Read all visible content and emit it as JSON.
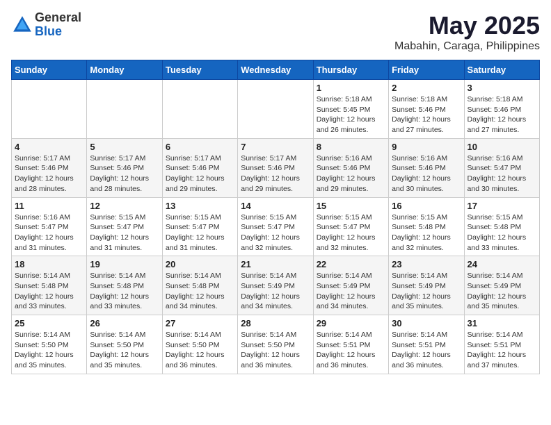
{
  "logo": {
    "general": "General",
    "blue": "Blue"
  },
  "title": "May 2025",
  "location": "Mabahin, Caraga, Philippines",
  "days_header": [
    "Sunday",
    "Monday",
    "Tuesday",
    "Wednesday",
    "Thursday",
    "Friday",
    "Saturday"
  ],
  "weeks": [
    [
      {
        "day": "",
        "info": ""
      },
      {
        "day": "",
        "info": ""
      },
      {
        "day": "",
        "info": ""
      },
      {
        "day": "",
        "info": ""
      },
      {
        "day": "1",
        "info": "Sunrise: 5:18 AM\nSunset: 5:45 PM\nDaylight: 12 hours\nand 26 minutes."
      },
      {
        "day": "2",
        "info": "Sunrise: 5:18 AM\nSunset: 5:46 PM\nDaylight: 12 hours\nand 27 minutes."
      },
      {
        "day": "3",
        "info": "Sunrise: 5:18 AM\nSunset: 5:46 PM\nDaylight: 12 hours\nand 27 minutes."
      }
    ],
    [
      {
        "day": "4",
        "info": "Sunrise: 5:17 AM\nSunset: 5:46 PM\nDaylight: 12 hours\nand 28 minutes."
      },
      {
        "day": "5",
        "info": "Sunrise: 5:17 AM\nSunset: 5:46 PM\nDaylight: 12 hours\nand 28 minutes."
      },
      {
        "day": "6",
        "info": "Sunrise: 5:17 AM\nSunset: 5:46 PM\nDaylight: 12 hours\nand 29 minutes."
      },
      {
        "day": "7",
        "info": "Sunrise: 5:17 AM\nSunset: 5:46 PM\nDaylight: 12 hours\nand 29 minutes."
      },
      {
        "day": "8",
        "info": "Sunrise: 5:16 AM\nSunset: 5:46 PM\nDaylight: 12 hours\nand 29 minutes."
      },
      {
        "day": "9",
        "info": "Sunrise: 5:16 AM\nSunset: 5:46 PM\nDaylight: 12 hours\nand 30 minutes."
      },
      {
        "day": "10",
        "info": "Sunrise: 5:16 AM\nSunset: 5:47 PM\nDaylight: 12 hours\nand 30 minutes."
      }
    ],
    [
      {
        "day": "11",
        "info": "Sunrise: 5:16 AM\nSunset: 5:47 PM\nDaylight: 12 hours\nand 31 minutes."
      },
      {
        "day": "12",
        "info": "Sunrise: 5:15 AM\nSunset: 5:47 PM\nDaylight: 12 hours\nand 31 minutes."
      },
      {
        "day": "13",
        "info": "Sunrise: 5:15 AM\nSunset: 5:47 PM\nDaylight: 12 hours\nand 31 minutes."
      },
      {
        "day": "14",
        "info": "Sunrise: 5:15 AM\nSunset: 5:47 PM\nDaylight: 12 hours\nand 32 minutes."
      },
      {
        "day": "15",
        "info": "Sunrise: 5:15 AM\nSunset: 5:47 PM\nDaylight: 12 hours\nand 32 minutes."
      },
      {
        "day": "16",
        "info": "Sunrise: 5:15 AM\nSunset: 5:48 PM\nDaylight: 12 hours\nand 32 minutes."
      },
      {
        "day": "17",
        "info": "Sunrise: 5:15 AM\nSunset: 5:48 PM\nDaylight: 12 hours\nand 33 minutes."
      }
    ],
    [
      {
        "day": "18",
        "info": "Sunrise: 5:14 AM\nSunset: 5:48 PM\nDaylight: 12 hours\nand 33 minutes."
      },
      {
        "day": "19",
        "info": "Sunrise: 5:14 AM\nSunset: 5:48 PM\nDaylight: 12 hours\nand 33 minutes."
      },
      {
        "day": "20",
        "info": "Sunrise: 5:14 AM\nSunset: 5:48 PM\nDaylight: 12 hours\nand 34 minutes."
      },
      {
        "day": "21",
        "info": "Sunrise: 5:14 AM\nSunset: 5:49 PM\nDaylight: 12 hours\nand 34 minutes."
      },
      {
        "day": "22",
        "info": "Sunrise: 5:14 AM\nSunset: 5:49 PM\nDaylight: 12 hours\nand 34 minutes."
      },
      {
        "day": "23",
        "info": "Sunrise: 5:14 AM\nSunset: 5:49 PM\nDaylight: 12 hours\nand 35 minutes."
      },
      {
        "day": "24",
        "info": "Sunrise: 5:14 AM\nSunset: 5:49 PM\nDaylight: 12 hours\nand 35 minutes."
      }
    ],
    [
      {
        "day": "25",
        "info": "Sunrise: 5:14 AM\nSunset: 5:50 PM\nDaylight: 12 hours\nand 35 minutes."
      },
      {
        "day": "26",
        "info": "Sunrise: 5:14 AM\nSunset: 5:50 PM\nDaylight: 12 hours\nand 35 minutes."
      },
      {
        "day": "27",
        "info": "Sunrise: 5:14 AM\nSunset: 5:50 PM\nDaylight: 12 hours\nand 36 minutes."
      },
      {
        "day": "28",
        "info": "Sunrise: 5:14 AM\nSunset: 5:50 PM\nDaylight: 12 hours\nand 36 minutes."
      },
      {
        "day": "29",
        "info": "Sunrise: 5:14 AM\nSunset: 5:51 PM\nDaylight: 12 hours\nand 36 minutes."
      },
      {
        "day": "30",
        "info": "Sunrise: 5:14 AM\nSunset: 5:51 PM\nDaylight: 12 hours\nand 36 minutes."
      },
      {
        "day": "31",
        "info": "Sunrise: 5:14 AM\nSunset: 5:51 PM\nDaylight: 12 hours\nand 37 minutes."
      }
    ]
  ]
}
